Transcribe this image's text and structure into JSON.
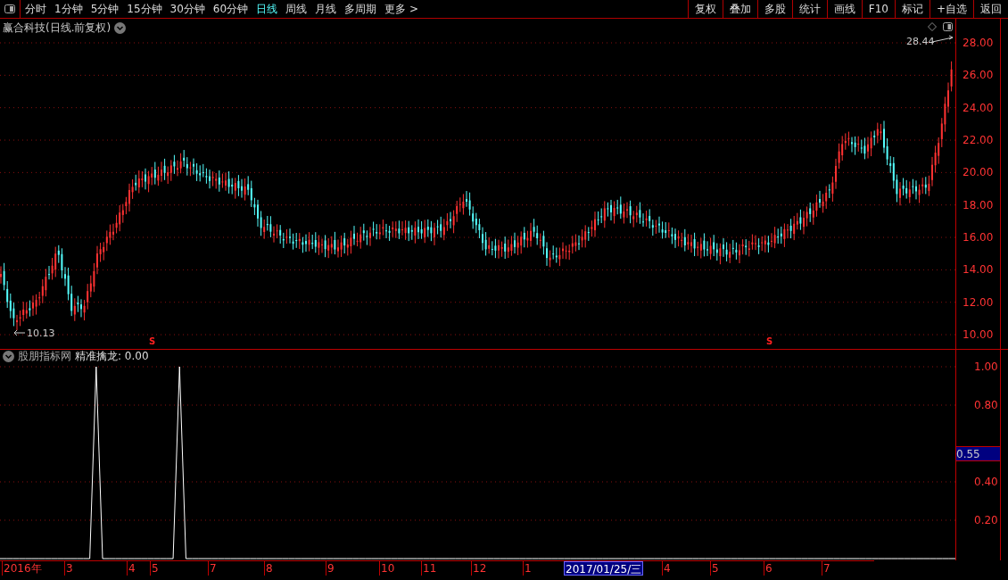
{
  "periods": [
    {
      "label": "分时",
      "selected": false
    },
    {
      "label": "1分钟",
      "selected": false
    },
    {
      "label": "5分钟",
      "selected": false
    },
    {
      "label": "15分钟",
      "selected": false
    },
    {
      "label": "30分钟",
      "selected": false
    },
    {
      "label": "60分钟",
      "selected": false
    },
    {
      "label": "日线",
      "selected": true
    },
    {
      "label": "周线",
      "selected": false
    },
    {
      "label": "月线",
      "selected": false
    },
    {
      "label": "多周期",
      "selected": false
    },
    {
      "label": "更多 >",
      "selected": false
    }
  ],
  "buttons": [
    "复权",
    "叠加",
    "多股",
    "统计",
    "画线",
    "F10",
    "标记",
    "+自选",
    "返回"
  ],
  "chart_title": "赢合科技(日线.前复权)",
  "price_axis": [
    "28.00",
    "26.00",
    "24.00",
    "22.00",
    "20.00",
    "18.00",
    "16.00",
    "14.00",
    "12.00",
    "10.00"
  ],
  "high_label": "28.44",
  "low_label": "10.13",
  "signal_marks": [
    "S",
    "S"
  ],
  "indicator": {
    "source": "股朋指标网",
    "reading": ": 0.00",
    "cursor_value": "0.55",
    "chart_data": {
      "type": "line",
      "categories": [
        null,
        null,
        null,
        null,
        null,
        null,
        null,
        null,
        null,
        null,
        null,
        null,
        null,
        null,
        null,
        null,
        null,
        null,
        null,
        null,
        null,
        null,
        null,
        null,
        null,
        null,
        null,
        null,
        null,
        null,
        null,
        null,
        null,
        null,
        null,
        null,
        null,
        null,
        null,
        null,
        null,
        null,
        null,
        null,
        null,
        null,
        null,
        null,
        null,
        null,
        null,
        null,
        null,
        null,
        null,
        null,
        null,
        null,
        null,
        null,
        null,
        null,
        null,
        null,
        null,
        null,
        null,
        null,
        null,
        null,
        null,
        null,
        null,
        null,
        null,
        null,
        null,
        null,
        null,
        null,
        null,
        null,
        null,
        null,
        null,
        null,
        null,
        null,
        null,
        null,
        null,
        null,
        null,
        null,
        null,
        null,
        null,
        null,
        null,
        null,
        null,
        null,
        null,
        null,
        null,
        null,
        null,
        null,
        null,
        null,
        null,
        null,
        null,
        null,
        null,
        null,
        null,
        null,
        null,
        null,
        null,
        null,
        null,
        null,
        null,
        null,
        null,
        null,
        null,
        null,
        null,
        null,
        null,
        null,
        null,
        null,
        null,
        null,
        null,
        null,
        null,
        null,
        null,
        null,
        null,
        null,
        null,
        null,
        null,
        null
      ],
      "series": [
        {
          "name": "精准擒龙",
          "color": "#ffffff",
          "values": [
            0,
            0,
            0,
            0,
            0,
            0,
            0,
            0,
            0,
            0,
            0,
            0,
            0,
            0,
            0,
            1,
            0,
            0,
            0,
            0,
            0,
            0,
            0,
            0,
            0,
            0,
            0,
            0,
            1,
            0,
            0,
            0,
            0,
            0,
            0,
            0,
            0,
            0,
            0,
            0,
            0,
            0,
            0,
            0,
            0,
            0,
            0,
            0,
            0,
            0,
            0,
            0,
            0,
            0,
            0,
            0,
            0,
            0,
            0,
            0,
            0,
            0,
            0,
            0,
            0,
            0,
            0,
            0,
            0,
            0,
            0,
            0,
            0,
            0,
            0,
            0,
            0,
            0,
            0,
            0,
            0,
            0,
            0,
            0,
            0,
            0,
            0,
            0,
            0,
            0,
            0,
            0,
            0,
            0,
            0,
            0,
            0,
            0,
            0,
            0,
            0,
            0,
            0,
            0,
            0,
            0,
            0,
            0,
            0,
            0,
            0,
            0,
            0,
            0,
            0,
            0,
            0,
            0,
            0,
            0,
            0,
            0,
            0,
            0,
            0,
            0,
            0,
            0,
            0,
            0,
            0,
            0,
            0,
            0,
            0,
            0,
            0,
            0,
            0,
            0,
            0,
            0,
            0,
            0,
            0,
            0,
            0,
            0,
            0,
            0
          ]
        }
      ],
      "ylim": [
        0,
        1.0
      ],
      "grid": true,
      "yticks": [
        {
          "value": 1,
          "label": "1.00"
        },
        {
          "value": 0.8,
          "label": "0.80"
        },
        {
          "value": 0.4,
          "label": "0.40"
        },
        {
          "value": 0.2,
          "label": "0.20"
        }
      ]
    }
  },
  "dates": [
    {
      "label": "2016年",
      "selected": false
    },
    {
      "label": "3",
      "selected": false
    },
    {
      "label": "4",
      "selected": false
    },
    {
      "label": "5",
      "selected": false
    },
    {
      "label": "7",
      "selected": false
    },
    {
      "label": "8",
      "selected": false
    },
    {
      "label": "9",
      "selected": false
    },
    {
      "label": "10",
      "selected": false
    },
    {
      "label": "11",
      "selected": false
    },
    {
      "label": "12",
      "selected": false
    },
    {
      "label": "1",
      "selected": false
    },
    {
      "label": "2017/01/25/三",
      "selected": true
    },
    {
      "label": "4",
      "selected": false
    },
    {
      "label": "5",
      "selected": false
    },
    {
      "label": "6",
      "selected": false
    },
    {
      "label": "7",
      "selected": false
    }
  ]
}
